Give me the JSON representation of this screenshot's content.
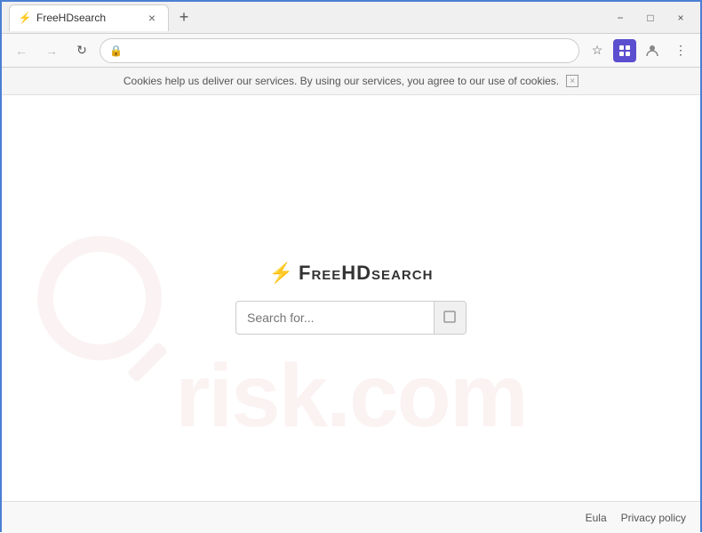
{
  "browser": {
    "tab": {
      "favicon": "⚡",
      "title": "FreeHDsearch",
      "close_label": "×"
    },
    "new_tab_label": "+",
    "window_controls": {
      "minimize": "−",
      "maximize": "□",
      "close": "×"
    },
    "toolbar": {
      "back_label": "←",
      "forward_label": "→",
      "refresh_label": "↻",
      "lock_icon": "🔒",
      "address": "",
      "star_label": "☆",
      "menu_label": "⋮"
    }
  },
  "cookie_banner": {
    "text": "Cookies help us deliver our services. By using our services, you agree to our use of cookies.",
    "close_label": "×"
  },
  "page": {
    "brand": {
      "bolt": "⚡",
      "name": "FreeHDsearch"
    },
    "search": {
      "placeholder": "Search for...",
      "button_label": "□"
    },
    "watermark": {
      "text": "risk.com"
    }
  },
  "footer": {
    "eula_label": "Eula",
    "privacy_label": "Privacy policy"
  }
}
